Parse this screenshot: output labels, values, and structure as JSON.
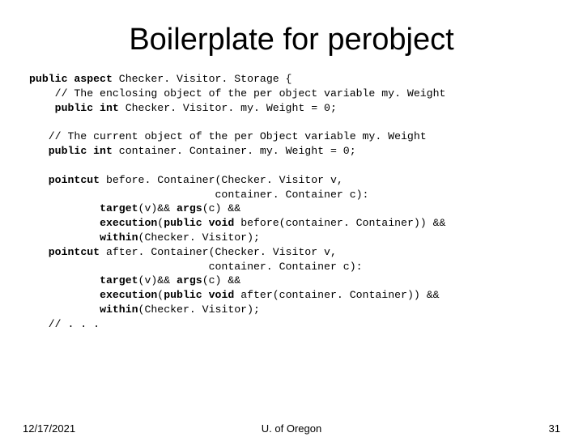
{
  "title": "Boilerplate for perobject",
  "code": [
    {
      "b": true,
      "t": "public aspect "
    },
    {
      "b": false,
      "t": "Checker. Visitor. Storage {\n"
    },
    {
      "b": false,
      "t": "    // The enclosing object of the per object variable my. Weight\n"
    },
    {
      "b": false,
      "t": "    "
    },
    {
      "b": true,
      "t": "public int"
    },
    {
      "b": false,
      "t": " Checker. Visitor. my. Weight = 0;\n"
    },
    {
      "b": false,
      "t": "\n"
    },
    {
      "b": false,
      "t": "   // The current object of the per Object variable my. Weight\n"
    },
    {
      "b": false,
      "t": "   "
    },
    {
      "b": true,
      "t": "public int"
    },
    {
      "b": false,
      "t": " container. Container. my. Weight = 0;\n"
    },
    {
      "b": false,
      "t": "\n"
    },
    {
      "b": false,
      "t": "   "
    },
    {
      "b": true,
      "t": "pointcut"
    },
    {
      "b": false,
      "t": " before. Container(Checker. Visitor v,\n"
    },
    {
      "b": false,
      "t": "                             container. Container c):\n"
    },
    {
      "b": false,
      "t": "           "
    },
    {
      "b": true,
      "t": "target"
    },
    {
      "b": false,
      "t": "(v)&& "
    },
    {
      "b": true,
      "t": "args"
    },
    {
      "b": false,
      "t": "(c) &&\n"
    },
    {
      "b": false,
      "t": "           "
    },
    {
      "b": true,
      "t": "execution"
    },
    {
      "b": false,
      "t": "("
    },
    {
      "b": true,
      "t": "public void"
    },
    {
      "b": false,
      "t": " before(container. Container)) &&\n"
    },
    {
      "b": false,
      "t": "           "
    },
    {
      "b": true,
      "t": "within"
    },
    {
      "b": false,
      "t": "(Checker. Visitor);\n"
    },
    {
      "b": false,
      "t": "   "
    },
    {
      "b": true,
      "t": "pointcut"
    },
    {
      "b": false,
      "t": " after. Container(Checker. Visitor v,\n"
    },
    {
      "b": false,
      "t": "                            container. Container c):\n"
    },
    {
      "b": false,
      "t": "           "
    },
    {
      "b": true,
      "t": "target"
    },
    {
      "b": false,
      "t": "(v)&& "
    },
    {
      "b": true,
      "t": "args"
    },
    {
      "b": false,
      "t": "(c) &&\n"
    },
    {
      "b": false,
      "t": "           "
    },
    {
      "b": true,
      "t": "execution"
    },
    {
      "b": false,
      "t": "("
    },
    {
      "b": true,
      "t": "public void"
    },
    {
      "b": false,
      "t": " after(container. Container)) &&\n"
    },
    {
      "b": false,
      "t": "           "
    },
    {
      "b": true,
      "t": "within"
    },
    {
      "b": false,
      "t": "(Checker. Visitor);\n"
    },
    {
      "b": false,
      "t": "   // . . ."
    }
  ],
  "footer": {
    "date": "12/17/2021",
    "org": "U. of Oregon",
    "page": "31"
  }
}
